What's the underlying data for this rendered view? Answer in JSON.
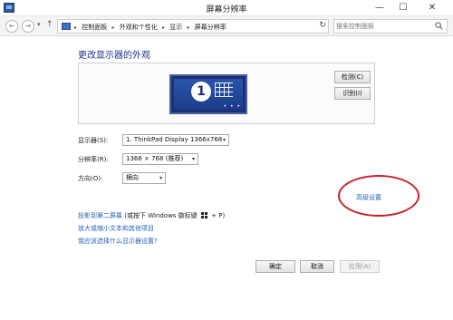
{
  "window": {
    "title": "屏幕分辨率",
    "min_glyph": "—",
    "max_glyph": "☐",
    "close_glyph": "✕"
  },
  "address_bar": {
    "back_glyph": "←",
    "forward_glyph": "→",
    "history_glyph": "▾",
    "up_glyph": "↑",
    "breadcrumb": [
      "控制面板",
      "外观和个性化",
      "显示",
      "屏幕分辨率"
    ],
    "separator": "▸",
    "refresh_glyph": "↻",
    "search_placeholder": "搜索控制面板"
  },
  "page": {
    "title": "更改显示器的外观"
  },
  "preview": {
    "monitor_number": "1",
    "detect_label": "检测(C)",
    "identify_label": "识别(I)"
  },
  "settings": {
    "display_label": "显示器(S):",
    "display_value": "1. ThinkPad Display 1366x768",
    "resolution_label": "分辨率(R):",
    "resolution_value": "1366 × 768 (推荐)",
    "orientation_label": "方向(O):",
    "orientation_value": "横向",
    "advanced_link": "高级设置"
  },
  "links": {
    "project_main": "投影到第二屏幕",
    "project_hint_pre": "(或按下 Windows 徽标键",
    "project_hint_post": "+ P)",
    "text_size": "放大或缩小文本和其他项目",
    "which_settings": "我应该选择什么显示器设置?"
  },
  "buttons": {
    "ok": "确定",
    "cancel": "取消",
    "apply": "应用(A)"
  },
  "colors": {
    "link": "#2a62b4",
    "title": "#1e3287",
    "highlight_ring": "#c8222a",
    "monitor": "#1b2f7a"
  }
}
